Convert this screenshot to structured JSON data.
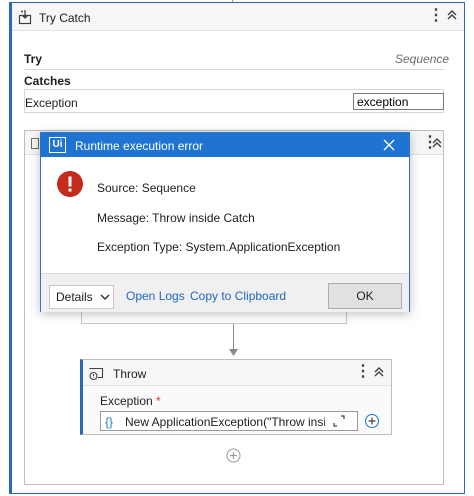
{
  "try_catch": {
    "title": "Try Catch",
    "try_label": "Try",
    "try_type": "Sequence",
    "catches_label": "Catches",
    "exception_label": "Exception",
    "exception_variable": "exception"
  },
  "throw_activity": {
    "title": "Throw",
    "exception_label": "Exception",
    "required_marker": "*",
    "expression_prefix": "{}",
    "expression": "New ApplicationException(\"Throw inside"
  },
  "dialog": {
    "app_icon_text": "Ui",
    "title": "Runtime execution error",
    "source": "Source: Sequence",
    "message": "Message: Throw inside Catch",
    "exception_type": "Exception Type: System.ApplicationException",
    "details_label": "Details",
    "open_logs_label": "Open Logs",
    "copy_label": "Copy to Clipboard",
    "ok_label": "OK"
  },
  "colors": {
    "accent": "#1f74d2",
    "error_icon": "#c42b1c",
    "link": "#1f66c1"
  }
}
